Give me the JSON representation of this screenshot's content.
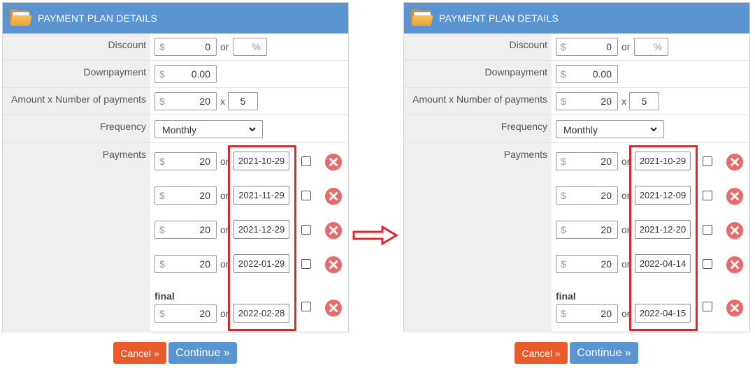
{
  "panel_title": "PAYMENT PLAN DETAILS",
  "labels": {
    "discount": "Discount",
    "downpayment": "Downpayment",
    "amount": "Amount x Number of payments",
    "frequency": "Frequency",
    "payments": "Payments",
    "final": "final"
  },
  "currency_symbol": "$",
  "percent_symbol": "%",
  "or_text": "or",
  "x_text": "x",
  "discount_value": "0",
  "downpayment_value": "0.00",
  "amount_value": "20",
  "count_value": "5",
  "frequency_value": "Monthly",
  "left": {
    "payments": [
      {
        "amount": "20",
        "date": "2021-10-29"
      },
      {
        "amount": "20",
        "date": "2021-11-29"
      },
      {
        "amount": "20",
        "date": "2021-12-29"
      },
      {
        "amount": "20",
        "date": "2022-01-29"
      },
      {
        "amount": "20",
        "date": "2022-02-28"
      }
    ]
  },
  "right": {
    "payments": [
      {
        "amount": "20",
        "date": "2021-10-29"
      },
      {
        "amount": "20",
        "date": "2021-12-09"
      },
      {
        "amount": "20",
        "date": "2021-12-20"
      },
      {
        "amount": "20",
        "date": "2022-04-14"
      },
      {
        "amount": "20",
        "date": "2022-04-15"
      }
    ]
  },
  "buttons": {
    "cancel": "Cancel »",
    "continue": "Continue »"
  },
  "colors": {
    "header": "#5b95d1",
    "highlight": "#e0262b",
    "cancel": "#ea5a2b",
    "continue": "#5b95d1",
    "delete": "#e86a6a"
  },
  "icons": {
    "header": "folder-icon",
    "delete": "delete-icon",
    "arrow": "right-arrow-icon"
  }
}
